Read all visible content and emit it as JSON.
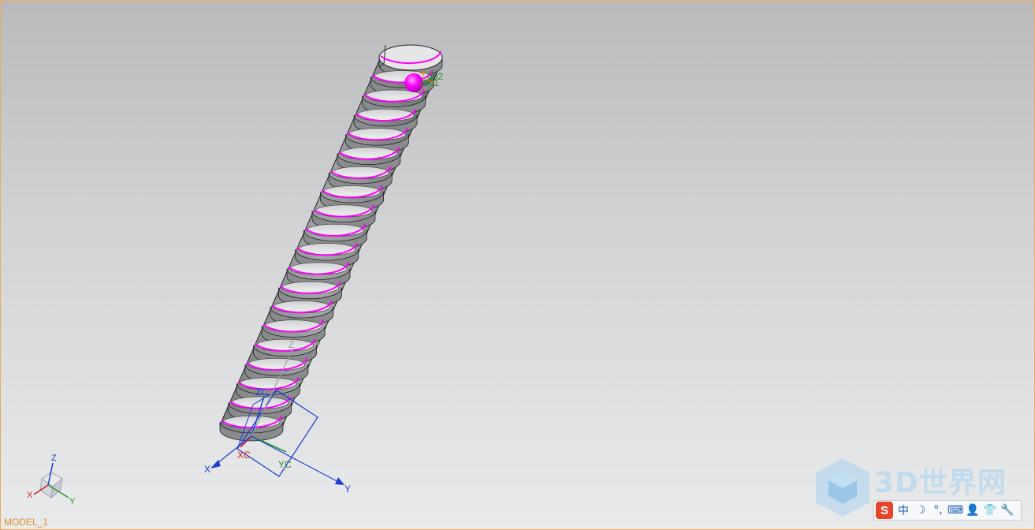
{
  "window": {
    "model_name": "MODEL_1"
  },
  "labels": {
    "point_1": "002",
    "point_2": "J001",
    "wcs_zc": "ZC",
    "wcs_yc": "YC",
    "wcs_xc": "XC",
    "abs_z": "Z",
    "abs_x": "X",
    "abs_y": "Y",
    "triad_z": "Z",
    "triad_x": "X",
    "triad_y": "Y"
  },
  "watermark": {
    "text": "3D世界网"
  },
  "ime": {
    "logo": "S",
    "items": [
      "中",
      "☽",
      "°,",
      "⌨",
      "👤",
      "👕",
      "🔧"
    ]
  },
  "colors": {
    "thread_gray": "#8e9092",
    "helix_magenta": "#ff00ff",
    "wcs_blue": "#1a3fd0",
    "accent_orange": "#e08a2a"
  }
}
